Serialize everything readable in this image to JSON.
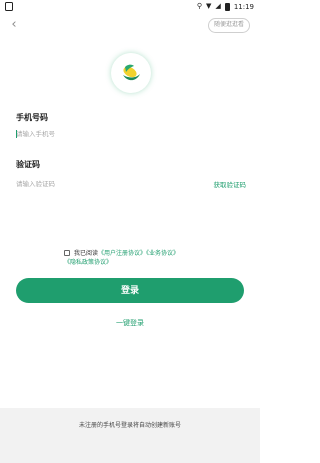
{
  "status_bar": {
    "time": "11:19",
    "icons": [
      "sim-icon",
      "location-icon",
      "wifi-icon",
      "signal-icon",
      "battery-icon"
    ]
  },
  "header": {
    "back_icon": "back-icon",
    "browse_label": "随便逛逛看"
  },
  "logo": {
    "icon": "corn-logo-icon",
    "colors": {
      "ring": "#2aa86f",
      "kernel": "#f2d22e",
      "husk": "#1f8a5a"
    }
  },
  "phone": {
    "label": "手机号码",
    "placeholder": "请输入手机号"
  },
  "code": {
    "label": "验证码",
    "placeholder": "请输入验证码",
    "get_code_label": "获取验证码"
  },
  "agreement": {
    "prefix": "我已阅读",
    "link_user": "《用户注册协议》",
    "link_service": "《业务协议》",
    "link_privacy": "《隐私政策协议》"
  },
  "login_button": "登录",
  "quick_login": "一键登录",
  "footer_note": "未注册的手机号登录将自动创建新账号",
  "colors": {
    "accent": "#1f9e6e",
    "footer_bg": "#f2f2f2"
  }
}
